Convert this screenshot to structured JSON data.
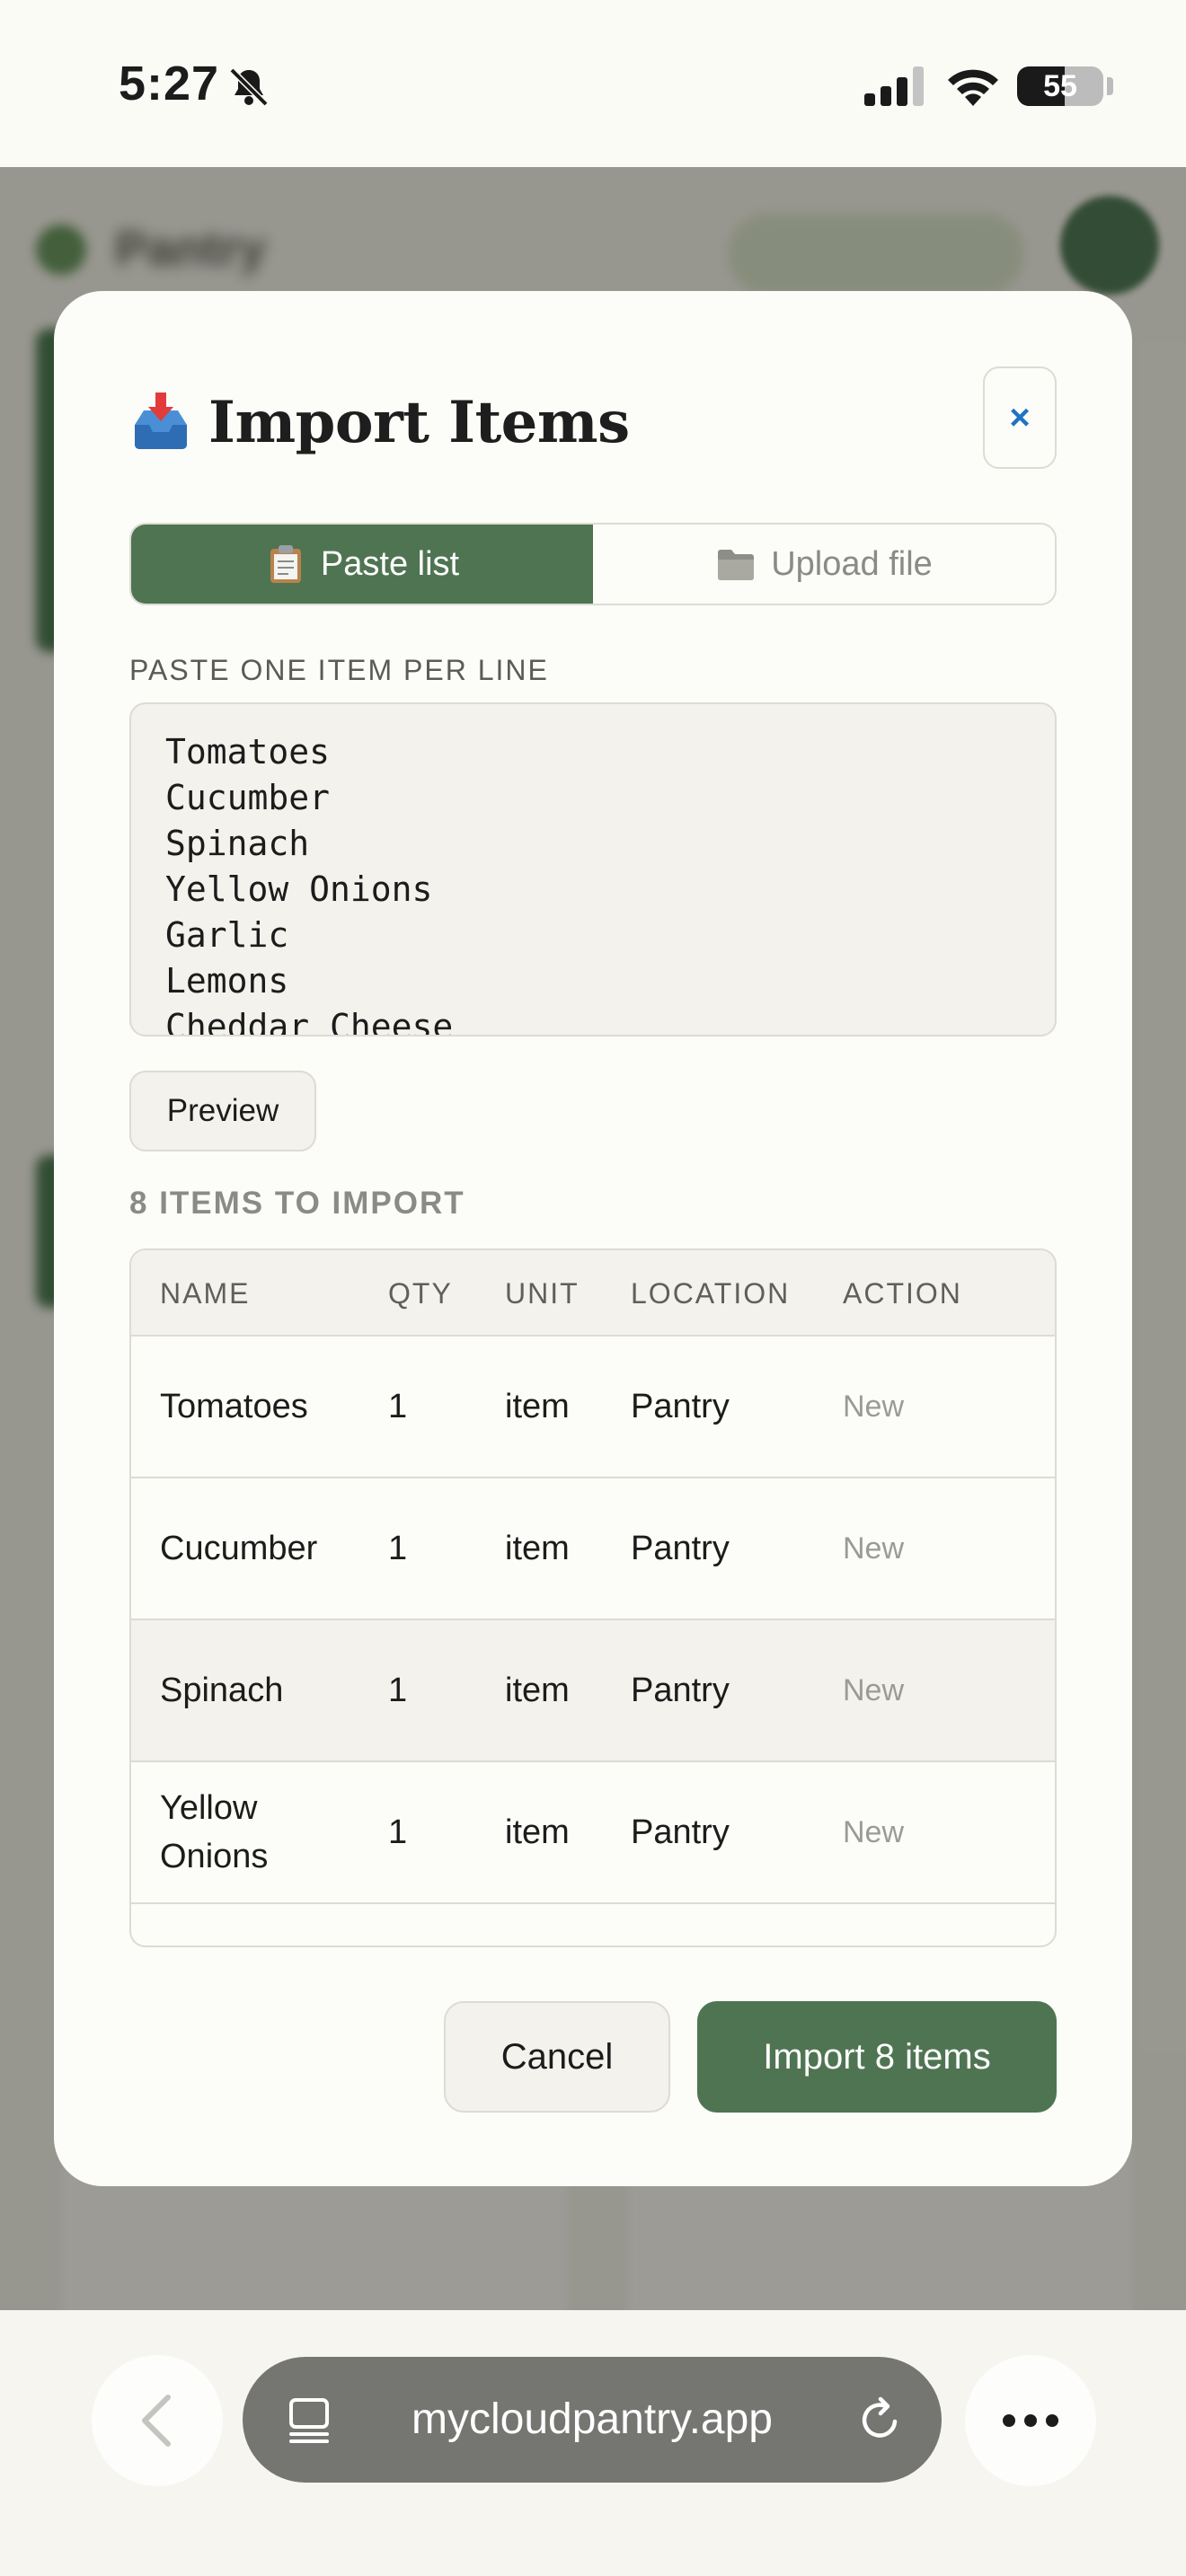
{
  "status_bar": {
    "time": "5:27",
    "battery_level": "55",
    "battery_fraction": 0.55,
    "icons": [
      "bell-slash-icon",
      "cellular-signal-icon",
      "wifi-icon",
      "battery-icon"
    ]
  },
  "modal": {
    "title": "Import Items",
    "title_icon": "inbox-tray-icon",
    "close_label": "×",
    "tabs": [
      {
        "label": "Paste list",
        "icon": "clipboard-icon",
        "active": true
      },
      {
        "label": "Upload file",
        "icon": "folder-icon",
        "active": false
      }
    ],
    "paste_label": "PASTE ONE ITEM PER LINE",
    "paste_lines": [
      "Tomatoes",
      "Cucumber",
      "Spinach",
      "Yellow Onions",
      "Garlic",
      "Lemons",
      "Cheddar Cheese"
    ],
    "preview_label": "Preview",
    "count_label": "8 ITEMS TO IMPORT",
    "table": {
      "headers": [
        "NAME",
        "QTY",
        "UNIT",
        "LOCATION",
        "ACTION"
      ],
      "rows": [
        {
          "name": "Tomatoes",
          "qty": "1",
          "unit": "item",
          "location": "Pantry",
          "action": "New"
        },
        {
          "name": "Cucumber",
          "qty": "1",
          "unit": "item",
          "location": "Pantry",
          "action": "New"
        },
        {
          "name": "Spinach",
          "qty": "1",
          "unit": "item",
          "location": "Pantry",
          "action": "New"
        },
        {
          "name": "Yellow Onions",
          "qty": "1",
          "unit": "item",
          "location": "Pantry",
          "action": "New"
        }
      ],
      "row_button_label": "›"
    },
    "cancel_label": "Cancel",
    "import_label": "Import 8 items"
  },
  "background_app": {
    "title": "Pantry"
  },
  "browser": {
    "url": "mycloudpantry.app",
    "icons": [
      "back-chevron-icon",
      "tabs-icon",
      "reload-icon",
      "more-icon"
    ]
  },
  "colors": {
    "accent_green": "#4f7452",
    "link_blue": "#1f73c6",
    "border": "#dcdcd4",
    "surface": "#fcfcf8",
    "muted_surface": "#f3f2ec"
  }
}
